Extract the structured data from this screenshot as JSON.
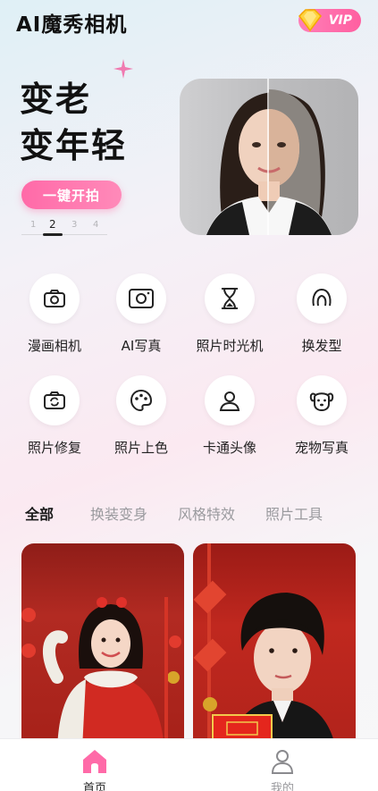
{
  "header": {
    "title": "AI魔秀相机",
    "vip_label": "VIP"
  },
  "hero": {
    "line1": "变老",
    "line2": "变年轻",
    "cta_label": "一键开拍",
    "pager": [
      "1",
      "2",
      "3",
      "4"
    ],
    "active_page": 2
  },
  "features": [
    {
      "label": "漫画相机",
      "icon": "camera-icon"
    },
    {
      "label": "AI写真",
      "icon": "photo-camera-icon"
    },
    {
      "label": "照片时光机",
      "icon": "hourglass-icon"
    },
    {
      "label": "换发型",
      "icon": "hair-icon"
    },
    {
      "label": "照片修复",
      "icon": "camera-refresh-icon"
    },
    {
      "label": "照片上色",
      "icon": "palette-icon"
    },
    {
      "label": "卡通头像",
      "icon": "user-icon"
    },
    {
      "label": "宠物写真",
      "icon": "dog-icon"
    }
  ],
  "tabs": [
    "全部",
    "换装变身",
    "风格特效",
    "照片工具"
  ],
  "active_tab": 0,
  "bottom_nav": [
    {
      "label": "首页",
      "icon": "home-icon",
      "active": true
    },
    {
      "label": "我的",
      "icon": "profile-icon",
      "active": false
    }
  ],
  "colors": {
    "accent": "#ff6aa8",
    "vip": "#ff5fa0",
    "card_red": "#b22a22"
  }
}
